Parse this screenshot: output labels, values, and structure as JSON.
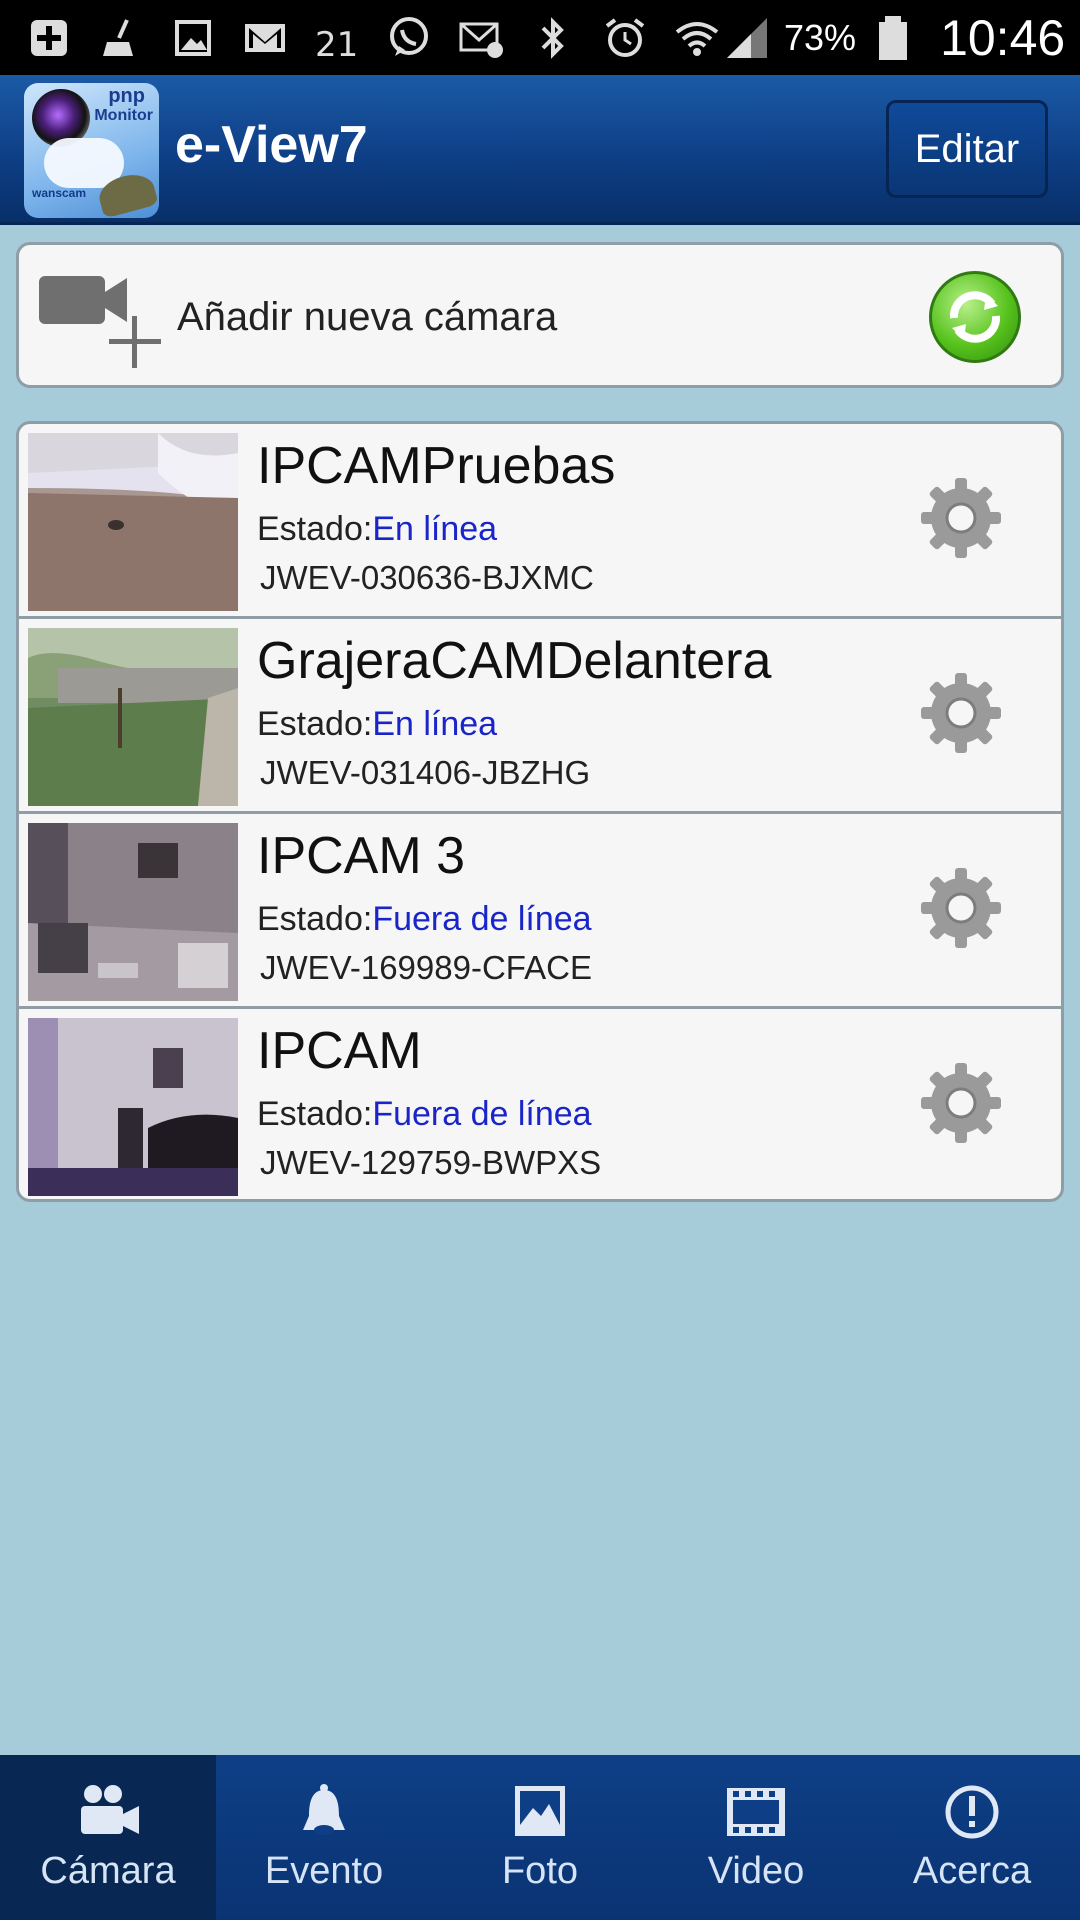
{
  "status_bar": {
    "icons": [
      "add-icon",
      "broom-icon",
      "image-icon",
      "gmail-icon",
      "weather-icon",
      "whatsapp-icon",
      "email-icon",
      "bluetooth-icon",
      "alarm-icon",
      "wifi-icon",
      "signal-icon",
      "battery-icon"
    ],
    "weather_temp": "21",
    "battery_percent": "73%",
    "time": "10:46"
  },
  "header": {
    "logo": {
      "line1": "pnp",
      "line2": "Monitor",
      "brand": "wanscam"
    },
    "title": "e-View7",
    "edit_label": "Editar"
  },
  "add_camera": {
    "label": "Añadir nueva cámara",
    "icon": "add-camera-icon",
    "refresh_icon": "refresh-icon",
    "refresh_color": "#57c21d"
  },
  "cameras": [
    {
      "name": "IPCAMPruebas",
      "status_label": "Estado:",
      "status_value": "En línea",
      "id": "JWEV-030636-BJXMC"
    },
    {
      "name": "GrajeraCAMDelantera",
      "status_label": "Estado:",
      "status_value": "En línea",
      "id": "JWEV-031406-JBZHG"
    },
    {
      "name": "IPCAM 3",
      "status_label": "Estado:",
      "status_value": "Fuera de línea",
      "id": "JWEV-169989-CFACE"
    },
    {
      "name": "IPCAM",
      "status_label": "Estado:",
      "status_value": "Fuera de línea",
      "id": "JWEV-129759-BWPXS"
    }
  ],
  "status_color": "#1a25c9",
  "bottom_nav": [
    {
      "label": "Cámara",
      "icon": "camera-icon",
      "active": true
    },
    {
      "label": "Evento",
      "icon": "bell-icon",
      "active": false
    },
    {
      "label": "Foto",
      "icon": "photo-icon",
      "active": false
    },
    {
      "label": "Video",
      "icon": "film-icon",
      "active": false
    },
    {
      "label": "Acerca",
      "icon": "info-icon",
      "active": false
    }
  ]
}
